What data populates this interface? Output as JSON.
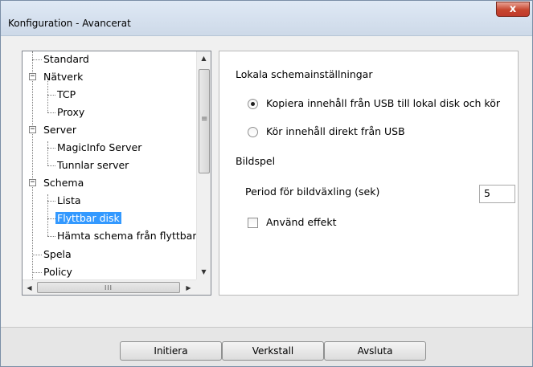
{
  "window": {
    "title": "Konfiguration - Avancerat",
    "close_label": "x"
  },
  "tree": {
    "items": [
      {
        "label": "Standard"
      },
      {
        "label": "Nätverk",
        "expander": "−"
      },
      {
        "label": "TCP"
      },
      {
        "label": "Proxy"
      },
      {
        "label": "Server",
        "expander": "−"
      },
      {
        "label": "MagicInfo Server"
      },
      {
        "label": "Tunnlar server"
      },
      {
        "label": "Schema",
        "expander": "−"
      },
      {
        "label": "Lista"
      },
      {
        "label": "Flyttbar disk",
        "selected": true
      },
      {
        "label": "Hämta schema från flyttbar disk"
      },
      {
        "label": "Spela"
      },
      {
        "label": "Policy"
      }
    ],
    "scroll_up_icon": "▲",
    "scroll_down_icon": "▼",
    "scroll_left_icon": "◀",
    "scroll_right_icon": "▶",
    "scroll_grip": "III",
    "vscroll_grip": "≡"
  },
  "settings": {
    "section_local": "Lokala schemainställningar",
    "radio_copy": "Kopiera innehåll från USB till lokal disk och kör",
    "radio_direct": "Kör innehåll direkt från USB",
    "section_slideshow": "Bildspel",
    "period_label": "Period för bildväxling (sek)",
    "period_value": "5",
    "effect_label": "Använd effekt"
  },
  "footer": {
    "init_label": "Initiera",
    "apply_label": "Verkstall",
    "exit_label": "Avsluta"
  }
}
